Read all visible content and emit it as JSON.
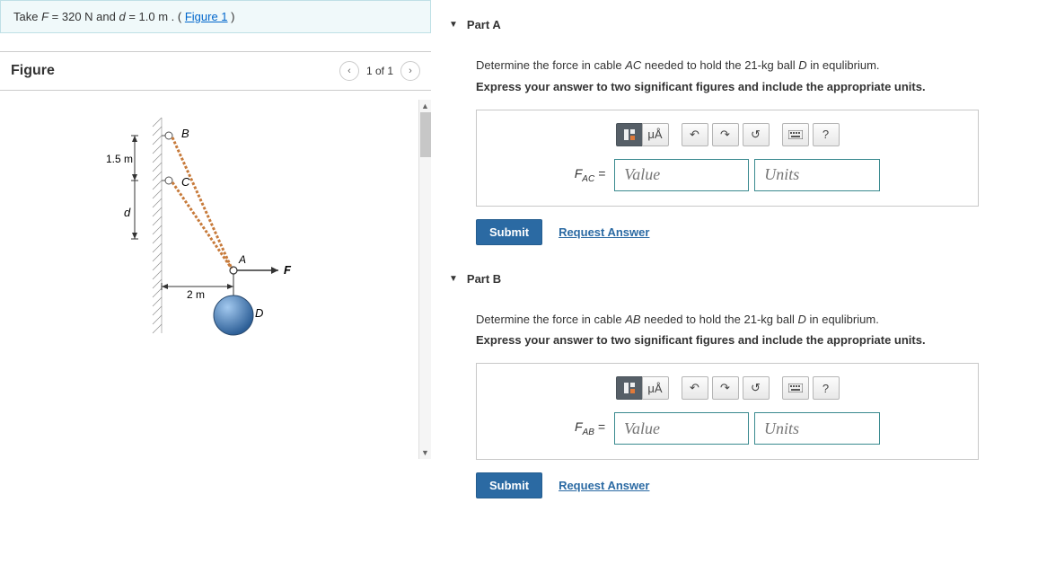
{
  "instruction": {
    "prefix": "Take ",
    "f_lhs": "F",
    "eq1": " = 320 N and ",
    "d_lhs": "d",
    "eq2": " = 1.0 m . (",
    "link": "Figure 1",
    "suffix": ")"
  },
  "figure": {
    "title": "Figure",
    "pager": "1 of 1",
    "labels": {
      "B": "B",
      "C": "C",
      "A": "A",
      "F": "F",
      "D": "D",
      "d": "d",
      "m15": "1.5 m",
      "m2": "2 m"
    }
  },
  "partA": {
    "title": "Part A",
    "prompt_pre": "Determine the force in cable ",
    "prompt_cable": "AC",
    "prompt_mid": " needed to hold the 21-",
    "prompt_kg": "kg",
    "prompt_mid2": " ball ",
    "prompt_ball": "D",
    "prompt_post": " in equlibrium.",
    "instr": "Express your answer to two significant figures and include the appropriate units.",
    "lhs_main": "F",
    "lhs_sub": "AC",
    "eq": " = ",
    "value_ph": "Value",
    "units_ph": "Units",
    "submit": "Submit",
    "request": "Request Answer",
    "tb_ua": "μÅ",
    "tb_help": "?"
  },
  "partB": {
    "title": "Part B",
    "prompt_pre": "Determine the force in cable ",
    "prompt_cable": "AB",
    "prompt_mid": " needed to hold the 21-",
    "prompt_kg": "kg",
    "prompt_mid2": " ball ",
    "prompt_ball": "D",
    "prompt_post": " in equlibrium.",
    "instr": "Express your answer to two significant figures and include the appropriate units.",
    "lhs_main": "F",
    "lhs_sub": "AB",
    "eq": " = ",
    "value_ph": "Value",
    "units_ph": "Units",
    "submit": "Submit",
    "request": "Request Answer",
    "tb_ua": "μÅ",
    "tb_help": "?"
  }
}
